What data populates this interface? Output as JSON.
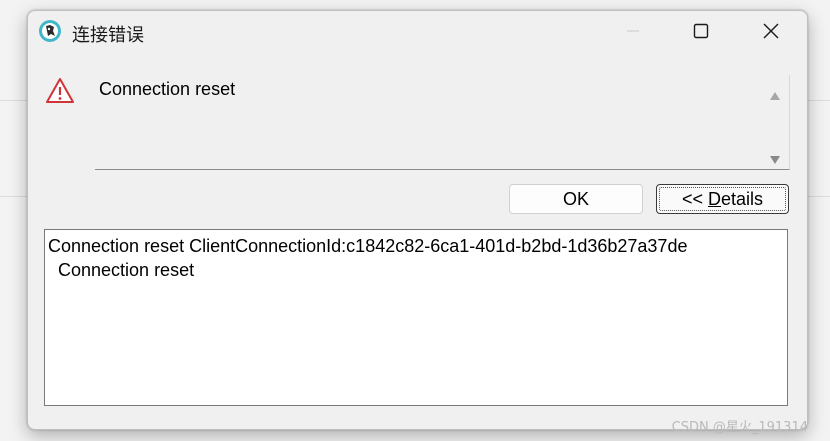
{
  "window": {
    "title": "连接错误",
    "minimize_label": "—",
    "maximize_label": "□",
    "close_label": "✕"
  },
  "message": {
    "text": "Connection reset",
    "icon": "warning-icon"
  },
  "buttons": {
    "ok_label": "OK",
    "details_prefix": "<< ",
    "details_mnemonic": "D",
    "details_rest": "etails"
  },
  "details": {
    "lines": [
      "Connection reset ClientConnectionId:c1842c82-6ca1-401d-b2bd-1d36b27a37de",
      "  Connection reset"
    ]
  },
  "watermark": "CSDN @星火_191314",
  "colors": {
    "warning": "#d13438",
    "dialog_bg": "#f0f0f0",
    "details_bg": "#ffffff"
  }
}
